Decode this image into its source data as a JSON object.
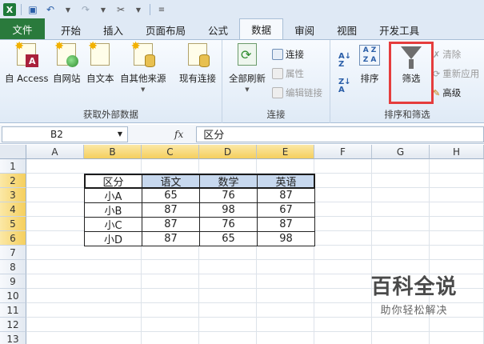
{
  "tabs": [
    "文件",
    "开始",
    "插入",
    "页面布局",
    "公式",
    "数据",
    "审阅",
    "视图",
    "开发工具"
  ],
  "active_tab": "数据",
  "ribbon": {
    "external_group": {
      "label": "获取外部数据",
      "access": "自 Access",
      "web": "自网站",
      "text": "自文本",
      "other": "自其他来源",
      "existing": "现有连接"
    },
    "connections_group": {
      "label": "连接",
      "refresh_all": "全部刷新",
      "connections": "连接",
      "properties": "属性",
      "edit_links": "编辑链接"
    },
    "sort_filter_group": {
      "label": "排序和筛选",
      "sort": "排序",
      "filter": "筛选",
      "clear": "清除",
      "reapply": "重新应用",
      "advanced": "高级"
    }
  },
  "formula_bar": {
    "name_box": "B2",
    "fx": "fx",
    "value": "区分"
  },
  "columns": [
    "A",
    "B",
    "C",
    "D",
    "E",
    "F",
    "G",
    "H"
  ],
  "rows": [
    "1",
    "2",
    "3",
    "4",
    "5",
    "6",
    "7",
    "8",
    "9",
    "10",
    "11",
    "12",
    "13"
  ],
  "table": {
    "headers": [
      "区分",
      "语文",
      "数学",
      "英语"
    ],
    "rows": [
      [
        "小A",
        "65",
        "76",
        "87"
      ],
      [
        "小B",
        "87",
        "98",
        "67"
      ],
      [
        "小C",
        "87",
        "76",
        "87"
      ],
      [
        "小D",
        "87",
        "65",
        "98"
      ]
    ]
  },
  "watermark": {
    "title": "百科全说",
    "subtitle": "助你轻松解决"
  }
}
